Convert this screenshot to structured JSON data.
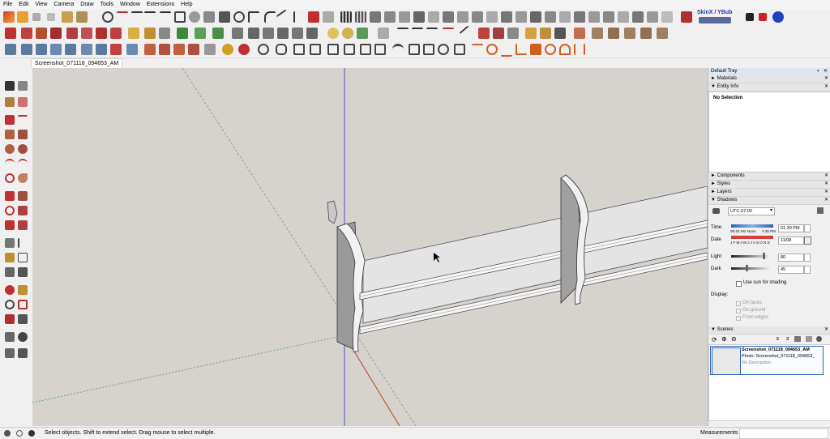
{
  "menu": [
    "File",
    "Edit",
    "View",
    "Camera",
    "Draw",
    "Tools",
    "Window",
    "Extensions",
    "Help"
  ],
  "toolbar": {
    "plugin_label": "SkinX / YBub"
  },
  "document_tab": "Screenshot_071118_094653_AM",
  "tray": {
    "title": "Default Tray",
    "panels": {
      "materials": "Materials",
      "entity_info": "Entity Info",
      "components": "Components",
      "styles": "Styles",
      "layers": "Layers",
      "shadows": "Shadows",
      "scenes": "Scenes"
    },
    "entity_status": "No Selection",
    "shadows": {
      "timezone": "UTC-07:00",
      "time_label": "Time",
      "time_start": "06:43 AM",
      "time_noon": "Noon",
      "time_end": "4:45 PM",
      "time_value": "01:30 PM",
      "date_label": "Date",
      "months": "J F M A M J J A S O N D",
      "date_value": "11/08",
      "light_label": "Light",
      "light_value": "80",
      "light_fraction": 0.8,
      "dark_label": "Dark",
      "dark_value": "45",
      "dark_fraction": 0.45,
      "use_sun": "Use sun for shading",
      "display_label": "Display:",
      "on_faces": "On faces",
      "on_ground": "On ground",
      "from_edges": "From edges"
    },
    "scene": {
      "name": "Screenshot_071118_094653_AM",
      "photo": "Photo: Screenshot_071118_094653_",
      "description": "No Description"
    }
  },
  "status": {
    "hint": "Select objects. Shift to extend select. Drag mouse to select multiple.",
    "measurements": "Measurements"
  },
  "colors": {
    "blue_axis": "#3030d0",
    "red_axis": "#c0301e",
    "green_axis": "#3a9a3a",
    "viewport_bg": "#d6d2cd",
    "shelf_face": "#e9e9e9",
    "shelf_side": "#9a9a9a",
    "accent": "#2a64b8"
  }
}
